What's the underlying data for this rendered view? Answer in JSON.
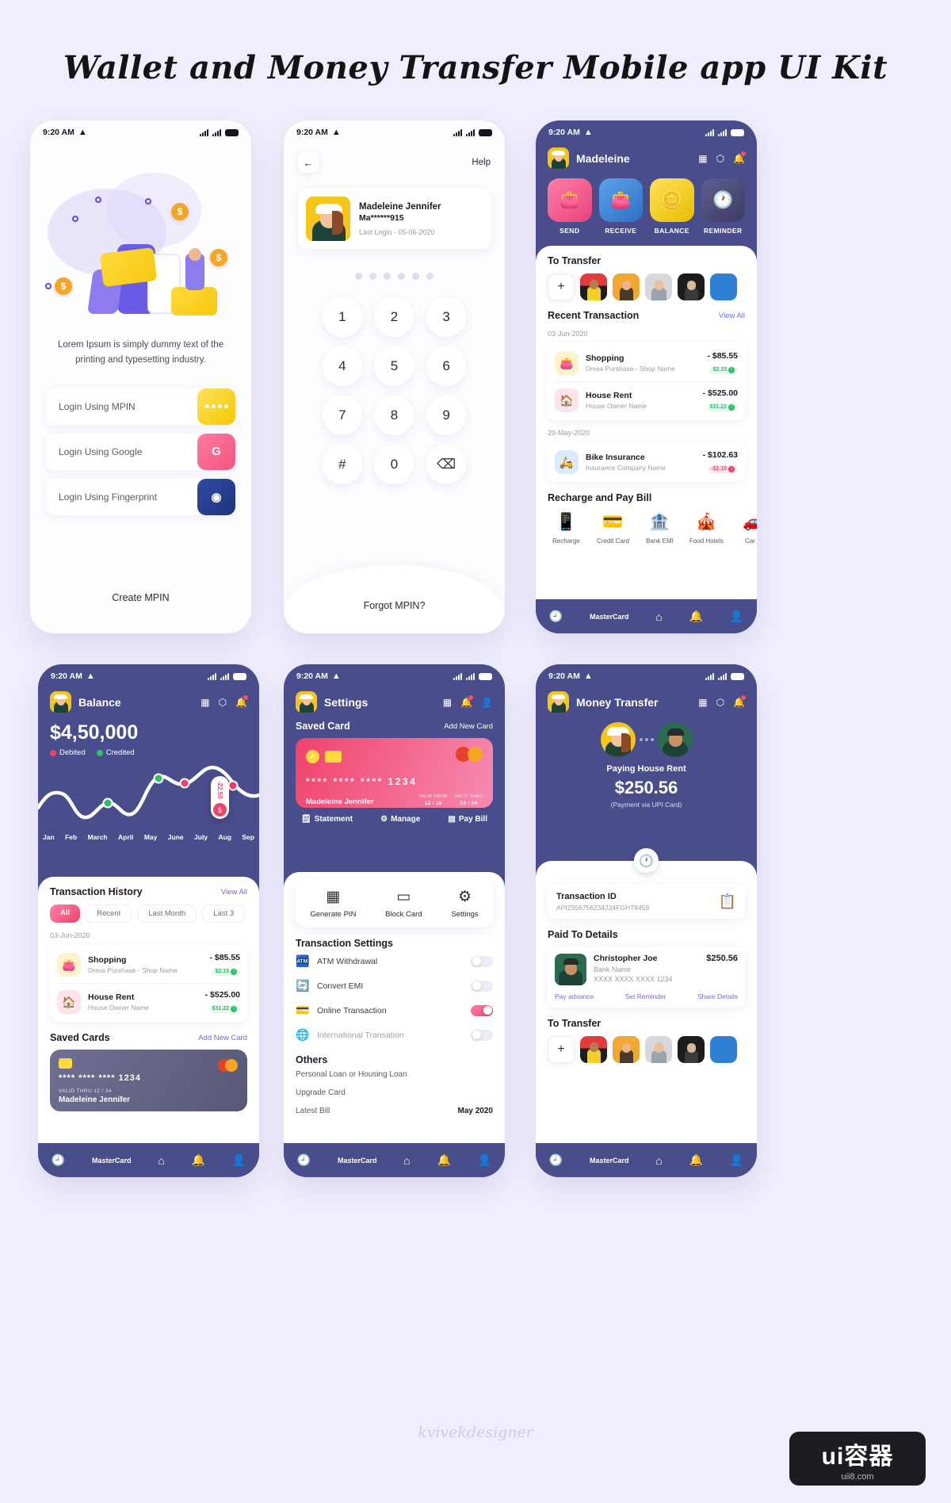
{
  "page": {
    "title": "Wallet and Money Transfer Mobile app UI Kit",
    "watermark": "kvivekdesigner"
  },
  "badge": {
    "line1": "ui容器",
    "line2": "uii8.com"
  },
  "status": {
    "time": "9:20 AM"
  },
  "screen1": {
    "lorem": "Lorem Ipsum is simply dummy text of the printing and typesetting industry.",
    "buttons": [
      {
        "label": "Login Using MPIN",
        "icon": "dots-icon"
      },
      {
        "label": "Login Using Google",
        "icon": "google-icon",
        "glyph": "G"
      },
      {
        "label": "Login Using Fingerprint",
        "icon": "fingerprint-icon",
        "glyph": "◉"
      }
    ],
    "create_mpin": "Create MPIN"
  },
  "screen2": {
    "help": "Help",
    "user": {
      "name": "Madeleine Jennifer",
      "masked": "Ma******915",
      "last_login": "Last Login - 05-06-2020"
    },
    "keys": [
      "1",
      "2",
      "3",
      "4",
      "5",
      "6",
      "7",
      "8",
      "9",
      "#",
      "0",
      "⌫"
    ],
    "forgot": "Forgot MPIN?"
  },
  "screen3": {
    "title": "Madeleine",
    "actions": [
      {
        "label": "SEND",
        "icon": "wallet-plus-icon"
      },
      {
        "label": "RECEIVE",
        "icon": "wallet-minus-icon"
      },
      {
        "label": "BALANCE",
        "icon": "dollar-coin-icon"
      },
      {
        "label": "REMINDER",
        "icon": "clock-icon"
      }
    ],
    "to_transfer": "To Transfer",
    "recent_title": "Recent Transaction",
    "view_all": "View All",
    "groups": [
      {
        "date": "03-Jun-2020",
        "items": [
          {
            "title": "Shopping",
            "sub": "Dress Purshase - Shop Name",
            "amount": "- $85.55",
            "pill": "$2.15",
            "pill_type": "g",
            "icon": "wallet-icon"
          },
          {
            "title": "House Rent",
            "sub": "House Owner Name",
            "amount": "- $525.00",
            "pill": "$31.22",
            "pill_type": "g",
            "icon": "house-icon"
          }
        ]
      },
      {
        "date": "29-May-2020",
        "items": [
          {
            "title": "Bike Insurance",
            "sub": "Insurance Company Name",
            "amount": "- $102.63",
            "pill": "-$2.15",
            "pill_type": "r",
            "icon": "bike-icon"
          }
        ]
      }
    ],
    "recharge_title": "Recharge and Pay Bill",
    "bills": [
      {
        "label": "Recharge",
        "icon": "mobile-icon"
      },
      {
        "label": "Credit Card",
        "icon": "credit-card-icon"
      },
      {
        "label": "Bank EMI",
        "icon": "bank-icon"
      },
      {
        "label": "Food Hotels",
        "icon": "food-icon"
      },
      {
        "label": "Car R",
        "icon": "car-icon"
      }
    ]
  },
  "screen4": {
    "title": "Balance",
    "amount": "$4,50,000",
    "legend": [
      {
        "label": "Debited",
        "color": "#f0436c"
      },
      {
        "label": "Credited",
        "color": "#2fbf6b"
      }
    ],
    "tooltip": "-22.50",
    "history_title": "Transaction History",
    "view_all": "View All",
    "chips": [
      "All",
      "Recent",
      "Last Month",
      "Last 3"
    ],
    "date": "03-Jun-2020",
    "items": [
      {
        "title": "Shopping",
        "sub": "Dress Purshase - Shop Name",
        "amount": "- $85.55",
        "pill": "$2.15",
        "pill_type": "g",
        "icon": "wallet-icon"
      },
      {
        "title": "House Rent",
        "sub": "House Owner Name",
        "amount": "- $525.00",
        "pill": "$31.22",
        "pill_type": "g",
        "icon": "house-icon"
      }
    ],
    "saved_title": "Saved Cards",
    "add_card": "Add New Card",
    "card": {
      "number": "**** **** **** 1234",
      "valid": "VALID THRU 12 / 34",
      "name": "Madeleine Jennifer",
      "brand": "MasterCard"
    }
  },
  "chart_data": {
    "type": "line",
    "title": "Balance",
    "categories": [
      "Jan",
      "Feb",
      "March",
      "April",
      "May",
      "June",
      "July",
      "Aug",
      "Sep"
    ],
    "values": [
      38,
      20,
      26,
      18,
      34,
      72,
      62,
      78,
      44
    ],
    "ylim": [
      0,
      100
    ],
    "grid": false,
    "annotations": [
      {
        "label": "-22.50",
        "type": "debited",
        "month": "June"
      }
    ],
    "points": [
      {
        "month": "March",
        "type": "credited",
        "color": "#2fbf6b"
      },
      {
        "month": "May",
        "type": "credited",
        "color": "#2fbf6b"
      },
      {
        "month": "June",
        "type": "debited",
        "color": "#f0436c"
      },
      {
        "month": "Aug",
        "type": "debited",
        "color": "#f0436c"
      }
    ],
    "legend": [
      "Debited",
      "Credited"
    ],
    "legend_position": "top-left"
  },
  "screen5": {
    "title": "Settings",
    "saved_card_title": "Saved Card",
    "add_new_card": "Add New Card",
    "card": {
      "number": "****  ****  ****  1234",
      "name": "Madeleine Jennifer",
      "valid_from_label": "VALID FROM",
      "valid_from": "12 / 19",
      "valid_thru_label": "VALID THRU",
      "valid_thru": "12 / 34"
    },
    "card_actions": [
      {
        "label": "Statement",
        "icon": "statement-icon"
      },
      {
        "label": "Manage",
        "icon": "gear-icon"
      },
      {
        "label": "Pay Bill",
        "icon": "pay-bill-icon"
      }
    ],
    "quick": [
      {
        "label": "Generate PIN",
        "icon": "keypad-icon"
      },
      {
        "label": "Block Card",
        "icon": "card-block-icon"
      },
      {
        "label": "Settings",
        "icon": "gear-icon"
      }
    ],
    "tx_settings_title": "Transaction Settings",
    "toggles": [
      {
        "label": "ATM Withdrawal",
        "on": false,
        "icon": "atm-icon"
      },
      {
        "label": "Convert EMI",
        "on": false,
        "icon": "convert-icon"
      },
      {
        "label": "Online Transaction",
        "on": true,
        "icon": "online-icon"
      },
      {
        "label": "International Transation",
        "on": false,
        "icon": "globe-icon"
      }
    ],
    "others_title": "Others",
    "others": [
      {
        "label": "Personal Loan or Housing Loan",
        "value": ""
      },
      {
        "label": "Upgrade Card",
        "value": ""
      },
      {
        "label": "Latest Bill",
        "value": "May 2020"
      }
    ]
  },
  "screen6": {
    "title": "Money Transfer",
    "paying": "Paying House Rent",
    "amount": "$250.56",
    "via": "(Payment via UPI Card)",
    "tx_id_label": "Transaction ID",
    "tx_id": "API2356756234234FGHT8459",
    "paid_title": "Paid To Details",
    "paid": {
      "name": "Christopher Joe",
      "bank": "Bank Name",
      "acct": "XXXX XXXX XXXX 1234",
      "amount": "$250.56"
    },
    "links": [
      "Pay advance",
      "Set Reminder",
      "Share Details"
    ],
    "to_transfer": "To Transfer"
  }
}
